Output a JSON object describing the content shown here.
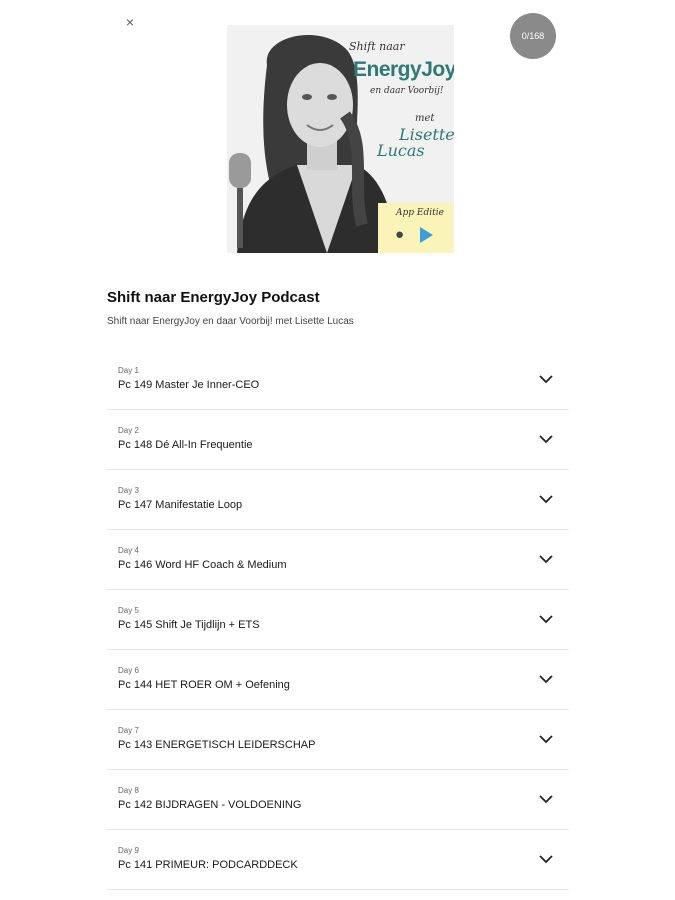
{
  "header": {
    "close_label": "×",
    "progress_text": "0/168"
  },
  "cover": {
    "line1": "Shift naar",
    "brand": "EnergyJoy",
    "line3": "en daar Voorbij!",
    "met": "met",
    "host_first": "Lisette",
    "host_last": "Lucas",
    "badge_text": "App Editie",
    "accent_color": "#2e7a73",
    "badge_color": "#fbf4b8"
  },
  "podcast": {
    "title": "Shift naar EnergyJoy Podcast",
    "subtitle": "Shift naar EnergyJoy en daar Voorbij! met Lisette Lucas"
  },
  "episodes": [
    {
      "day": "Day 1",
      "title": "Pc 149 Master Je Inner-CEO"
    },
    {
      "day": "Day 2",
      "title": "Pc 148 Dé All-In Frequentie"
    },
    {
      "day": "Day 3",
      "title": "Pc 147 Manifestatie Loop"
    },
    {
      "day": "Day 4",
      "title": "Pc 146 Word HF Coach & Medium"
    },
    {
      "day": "Day 5",
      "title": "Pc 145 Shift Je Tijdlijn + ETS"
    },
    {
      "day": "Day 6",
      "title": "Pc 144 HET ROER OM + Oefening"
    },
    {
      "day": "Day 7",
      "title": "Pc 143 ENERGETISCH LEIDERSCHAP"
    },
    {
      "day": "Day 8",
      "title": "Pc 142 BIJDRAGEN - VOLDOENING"
    },
    {
      "day": "Day 9",
      "title": "Pc 141 PRIMEUR: PODCARDDECK"
    }
  ]
}
